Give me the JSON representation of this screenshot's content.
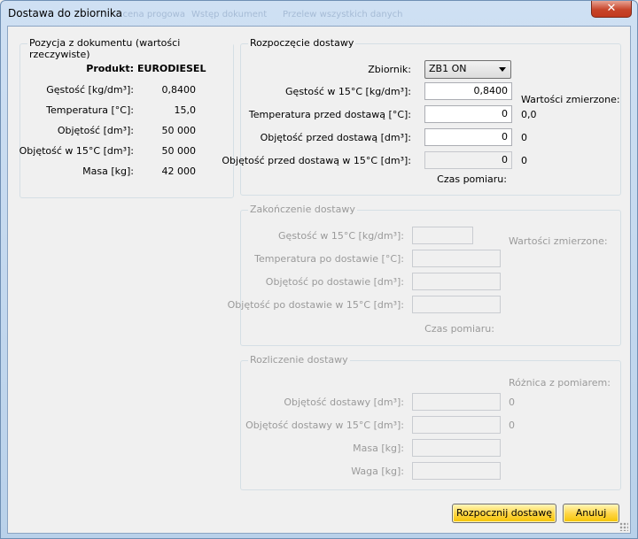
{
  "window": {
    "title": "Dostawa do zbiornika",
    "ghost_tabs": [
      "...cena progowa",
      "Wstęp dokument",
      "Przelew wszystkich danych"
    ],
    "close_symbol": "✕"
  },
  "left_group": {
    "legend": "Pozycja z dokumentu (wartości rzeczywiste)",
    "rows": [
      {
        "label": "Produkt:",
        "value": "EURODIESEL"
      },
      {
        "label": "Gęstość [kg/dm³]:",
        "value": "0,8400"
      },
      {
        "label": "Temperatura [°C]:",
        "value": "15,0"
      },
      {
        "label": "Objętość [dm³]:",
        "value": "50 000"
      },
      {
        "label": "Objętość w 15°C [dm³]:",
        "value": "50 000"
      },
      {
        "label": "Masa [kg]:",
        "value": "42 000"
      }
    ]
  },
  "start_group": {
    "legend": "Rozpoczęcie dostawy",
    "tank_label": "Zbiornik:",
    "tank_value": "ZB1 ON",
    "measured_header": "Wartości zmierzone:",
    "rows": [
      {
        "label": "Gęstość w 15°C [kg/dm³]:",
        "value": "0,8400",
        "measured": ""
      },
      {
        "label": "Temperatura przed dostawą [°C]:",
        "value": "0",
        "measured": "0,0"
      },
      {
        "label": "Objętość przed dostawą [dm³]:",
        "value": "0",
        "measured": "0"
      },
      {
        "label": "Objętość przed dostawą w 15°C [dm³]:",
        "value": "0",
        "measured": "0"
      }
    ],
    "measure_time_label": "Czas pomiaru:"
  },
  "end_group": {
    "legend": "Zakończenie dostawy",
    "measured_header": "Wartości zmierzone:",
    "rows": [
      {
        "label": "Gęstość w 15°C [kg/dm³]:",
        "value": ""
      },
      {
        "label": "Temperatura po dostawie [°C]:",
        "value": ""
      },
      {
        "label": "Objętość po dostawie [dm³]:",
        "value": ""
      },
      {
        "label": "Objętość po dostawie w 15°C [dm³]:",
        "value": ""
      }
    ],
    "measure_time_label": "Czas pomiaru:"
  },
  "settle_group": {
    "legend": "Rozliczenie dostawy",
    "diff_header": "Różnica z pomiarem:",
    "rows": [
      {
        "label": "Objętość dostawy [dm³]:",
        "value": "",
        "diff": "0"
      },
      {
        "label": "Objętość dostawy w 15°C [dm³]:",
        "value": "",
        "diff": "0"
      },
      {
        "label": "Masa [kg]:",
        "value": "",
        "diff": ""
      },
      {
        "label": "Waga [kg]:",
        "value": "",
        "diff": ""
      }
    ]
  },
  "buttons": {
    "start": "Rozpocznij dostawę",
    "cancel": "Anuluj"
  }
}
